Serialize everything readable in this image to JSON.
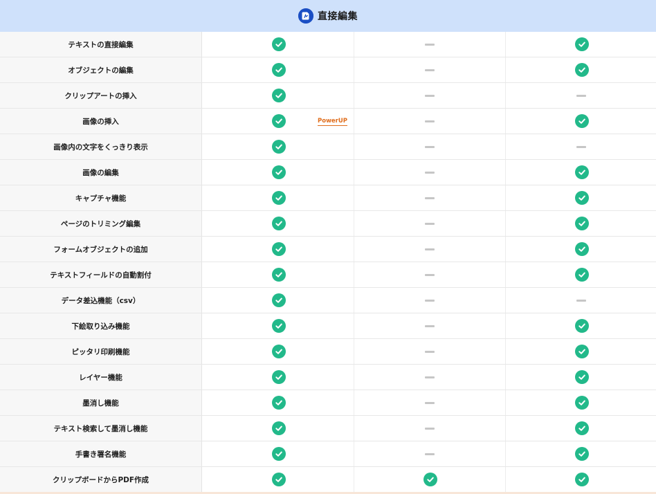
{
  "header": {
    "title": "直接編集",
    "icon": "app-logo-icon",
    "bg": "#cfe1fb"
  },
  "colors": {
    "check": "#22b98a",
    "dash": "#c6c6c6",
    "badge": "#e06d1c"
  },
  "rows": [
    {
      "label": "テキストの直接編集",
      "a": "check",
      "b": "dash",
      "c": "check"
    },
    {
      "label": "オブジェクトの編集",
      "a": "check",
      "b": "dash",
      "c": "check"
    },
    {
      "label": "クリップアートの挿入",
      "a": "check",
      "b": "dash",
      "c": "dash"
    },
    {
      "label": "画像の挿入",
      "a": "check",
      "badge": "PowerUP",
      "b": "dash",
      "c": "check"
    },
    {
      "label": "画像内の文字をくっきり表示",
      "a": "check",
      "b": "dash",
      "c": "dash"
    },
    {
      "label": "画像の編集",
      "a": "check",
      "b": "dash",
      "c": "check"
    },
    {
      "label": "キャプチャ機能",
      "a": "check",
      "b": "dash",
      "c": "check"
    },
    {
      "label": "ページのトリミング編集",
      "a": "check",
      "b": "dash",
      "c": "check"
    },
    {
      "label": "フォームオブジェクトの追加",
      "a": "check",
      "b": "dash",
      "c": "check"
    },
    {
      "label": "テキストフィールドの自動割付",
      "a": "check",
      "b": "dash",
      "c": "check"
    },
    {
      "label": "データ差込機能（csv）",
      "a": "check",
      "b": "dash",
      "c": "dash"
    },
    {
      "label": "下絵取り込み機能",
      "a": "check",
      "b": "dash",
      "c": "check"
    },
    {
      "label": "ピッタリ印刷機能",
      "a": "check",
      "b": "dash",
      "c": "check"
    },
    {
      "label": "レイヤー機能",
      "a": "check",
      "b": "dash",
      "c": "check"
    },
    {
      "label": "墨消し機能",
      "a": "check",
      "b": "dash",
      "c": "check"
    },
    {
      "label": "テキスト検索して墨消し機能",
      "a": "check",
      "b": "dash",
      "c": "check"
    },
    {
      "label": "手書き署名機能",
      "a": "check",
      "b": "dash",
      "c": "check"
    },
    {
      "label": "クリップボードからPDF作成",
      "a": "check",
      "b": "check",
      "c": "check"
    }
  ]
}
